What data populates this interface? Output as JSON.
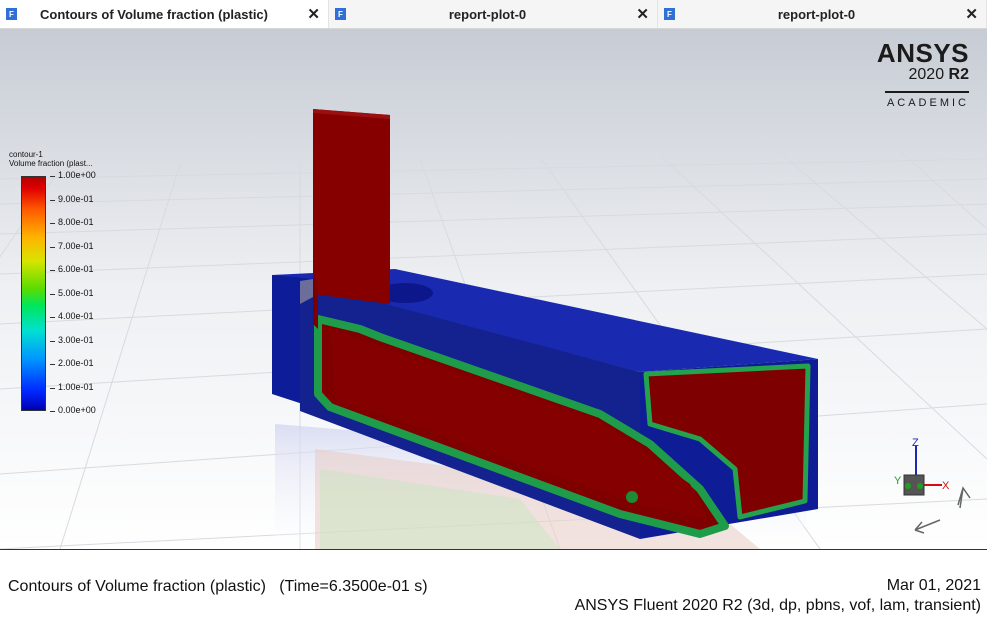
{
  "tabs": [
    {
      "label": "Contours of Volume fraction (plastic)",
      "icon": "fluent-icon",
      "icon_text": "F",
      "close": "✕",
      "active": true
    },
    {
      "label": "report-plot-0",
      "icon": "fluent-icon",
      "icon_text": "F",
      "close": "✕",
      "active": false
    },
    {
      "label": "report-plot-0",
      "icon": "fluent-icon",
      "icon_text": "F",
      "close": "✕",
      "active": false
    }
  ],
  "logo": {
    "brand": "ANSYS",
    "version_year": "2020",
    "version_release": "R2",
    "edition": "ACADEMIC"
  },
  "colormap": {
    "name": "contour-1",
    "variable": "Volume fraction (plast...",
    "labels": [
      "1.00e+00",
      "9.00e-01",
      "8.00e-01",
      "7.00e-01",
      "6.00e-01",
      "5.00e-01",
      "4.00e-01",
      "3.00e-01",
      "2.00e-01",
      "1.00e-01",
      "0.00e+00"
    ]
  },
  "triad": {
    "x": "X",
    "y": "Y",
    "z": "Z"
  },
  "footer": {
    "title": "Contours of Volume fraction (plastic)   (Time=6.3500e-01 s)",
    "date": "Mar 01, 2021",
    "solver": "ANSYS Fluent 2020 R2 (3d, dp, pbns, vof, lam, transient)"
  },
  "colors": {
    "fluid_plastic": "#8b0000",
    "fluid_air": "#0a1aa0",
    "background_top": "#c9ced6",
    "background_bottom": "#ffffff"
  }
}
